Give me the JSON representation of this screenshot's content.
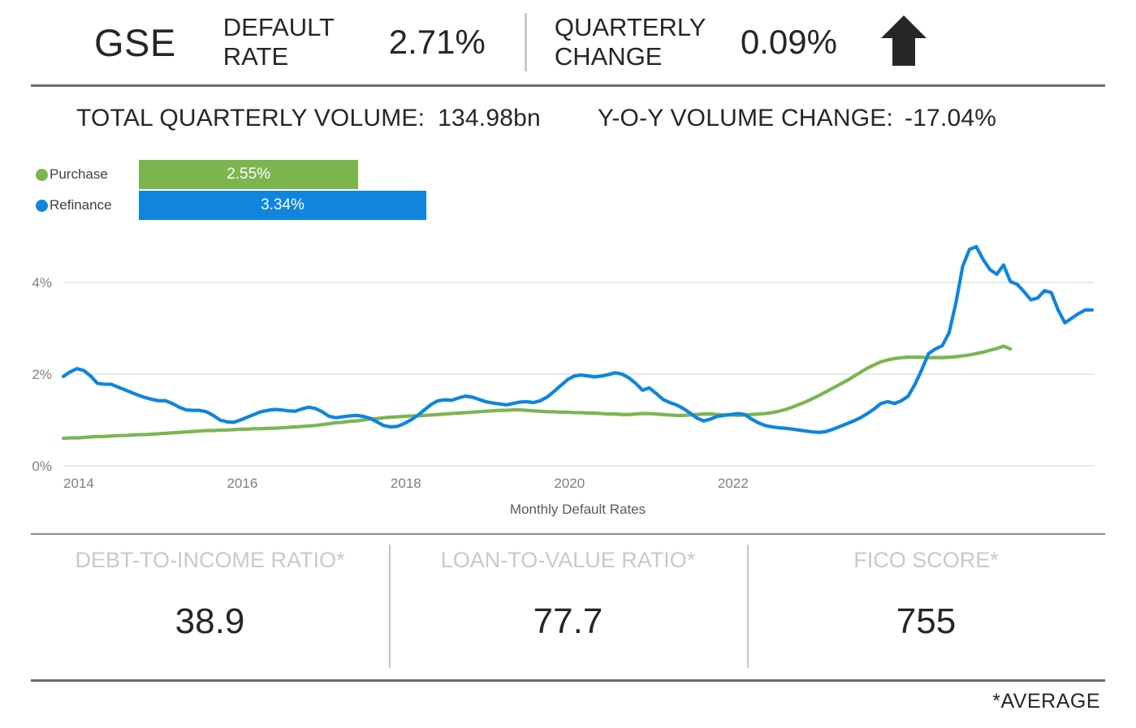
{
  "header": {
    "entity": "GSE",
    "default_rate_label": "DEFAULT RATE",
    "default_rate_value": "2.71%",
    "quarterly_change_label": "QUARTERLY CHANGE",
    "quarterly_change_value": "0.09%",
    "trend_direction": "up",
    "trend_icon": "arrow-up-icon",
    "trend_color": "#262626"
  },
  "volume": {
    "total_label": "TOTAL QUARTERLY VOLUME:",
    "total_value": "134.98bn",
    "yoy_label": "Y-O-Y VOLUME CHANGE:",
    "yoy_value": "-17.04%"
  },
  "legend": {
    "purchase": {
      "label": "Purchase",
      "value_label": "2.55%",
      "value": 2.55,
      "color": "#7CB550"
    },
    "refinance": {
      "label": "Refinance",
      "value_label": "3.34%",
      "value": 3.34,
      "color": "#0F85DE"
    }
  },
  "metrics": [
    {
      "title": "DEBT-TO-INCOME RATIO*",
      "value": "38.9"
    },
    {
      "title": "LOAN-TO-VALUE RATIO*",
      "value": "77.7"
    },
    {
      "title": "FICO SCORE*",
      "value": "755"
    }
  ],
  "footnote": "*AVERAGE",
  "chart_data": {
    "type": "line",
    "title": "",
    "xlabel": "Monthly Default Rates",
    "ylabel": "",
    "xlim": [
      2014.0,
      2023.12
    ],
    "ylim": [
      0,
      5.2
    ],
    "yticks": [
      0,
      2,
      4
    ],
    "ytick_labels": [
      "0%",
      "2%",
      "4%"
    ],
    "xticks": [
      2014,
      2016,
      2018,
      2020,
      2022
    ],
    "xtick_labels": [
      "2014",
      "2016",
      "2018",
      "2020",
      "2022"
    ],
    "grid": "horizontal",
    "legend_position": "top-left",
    "x_start": 2014.0,
    "x_step": 0.0833,
    "series": [
      {
        "name": "Purchase",
        "color": "#7CB550",
        "values": [
          0.6,
          0.61,
          0.61,
          0.62,
          0.63,
          0.64,
          0.64,
          0.65,
          0.66,
          0.66,
          0.67,
          0.68,
          0.68,
          0.69,
          0.7,
          0.71,
          0.72,
          0.73,
          0.74,
          0.75,
          0.76,
          0.77,
          0.77,
          0.78,
          0.78,
          0.79,
          0.8,
          0.8,
          0.81,
          0.81,
          0.82,
          0.82,
          0.83,
          0.84,
          0.85,
          0.86,
          0.87,
          0.88,
          0.9,
          0.92,
          0.94,
          0.95,
          0.97,
          0.98,
          1.0,
          1.02,
          1.03,
          1.05,
          1.06,
          1.07,
          1.08,
          1.09,
          1.09,
          1.1,
          1.11,
          1.12,
          1.13,
          1.14,
          1.15,
          1.16,
          1.17,
          1.18,
          1.19,
          1.2,
          1.21,
          1.21,
          1.22,
          1.22,
          1.21,
          1.2,
          1.19,
          1.18,
          1.18,
          1.17,
          1.17,
          1.16,
          1.16,
          1.15,
          1.15,
          1.14,
          1.13,
          1.13,
          1.12,
          1.12,
          1.13,
          1.14,
          1.14,
          1.13,
          1.12,
          1.11,
          1.1,
          1.1,
          1.11,
          1.12,
          1.13,
          1.13,
          1.12,
          1.11,
          1.11,
          1.1,
          1.11,
          1.12,
          1.13,
          1.14,
          1.16,
          1.19,
          1.23,
          1.28,
          1.34,
          1.4,
          1.47,
          1.54,
          1.62,
          1.7,
          1.78,
          1.86,
          1.95,
          2.04,
          2.13,
          2.2,
          2.27,
          2.31,
          2.34,
          2.36,
          2.37,
          2.37,
          2.37,
          2.36,
          2.36,
          2.36,
          2.37,
          2.38,
          2.4,
          2.42,
          2.45,
          2.48,
          2.52,
          2.56,
          2.61,
          2.55
        ]
      },
      {
        "name": "Refinance",
        "color": "#0F85DE",
        "values": [
          1.95,
          2.05,
          2.12,
          2.08,
          1.96,
          1.8,
          1.78,
          1.78,
          1.72,
          1.66,
          1.6,
          1.54,
          1.49,
          1.45,
          1.42,
          1.42,
          1.36,
          1.28,
          1.22,
          1.21,
          1.21,
          1.18,
          1.1,
          1.0,
          0.96,
          0.95,
          1.0,
          1.06,
          1.12,
          1.18,
          1.21,
          1.23,
          1.22,
          1.2,
          1.19,
          1.24,
          1.28,
          1.25,
          1.18,
          1.08,
          1.05,
          1.07,
          1.09,
          1.1,
          1.08,
          1.04,
          0.96,
          0.88,
          0.85,
          0.86,
          0.92,
          1.0,
          1.1,
          1.22,
          1.34,
          1.42,
          1.44,
          1.43,
          1.48,
          1.52,
          1.5,
          1.45,
          1.4,
          1.37,
          1.35,
          1.33,
          1.36,
          1.39,
          1.4,
          1.38,
          1.42,
          1.5,
          1.62,
          1.75,
          1.88,
          1.96,
          1.98,
          1.96,
          1.94,
          1.96,
          1.99,
          2.03,
          2.0,
          1.92,
          1.8,
          1.65,
          1.7,
          1.58,
          1.45,
          1.38,
          1.33,
          1.25,
          1.15,
          1.04,
          0.98,
          1.02,
          1.08,
          1.1,
          1.12,
          1.14,
          1.12,
          1.02,
          0.94,
          0.88,
          0.85,
          0.83,
          0.82,
          0.8,
          0.78,
          0.76,
          0.74,
          0.73,
          0.75,
          0.8,
          0.86,
          0.92,
          0.98,
          1.05,
          1.14,
          1.24,
          1.36,
          1.4,
          1.36,
          1.42,
          1.52,
          1.78,
          2.1,
          2.45,
          2.55,
          2.62,
          2.9,
          3.55,
          4.35,
          4.72,
          4.78,
          4.5,
          4.28,
          4.18,
          4.38,
          4.02,
          3.96,
          3.8,
          3.62,
          3.66,
          3.82,
          3.78,
          3.4,
          3.12,
          3.22,
          3.32,
          3.4,
          3.4
        ]
      }
    ]
  }
}
